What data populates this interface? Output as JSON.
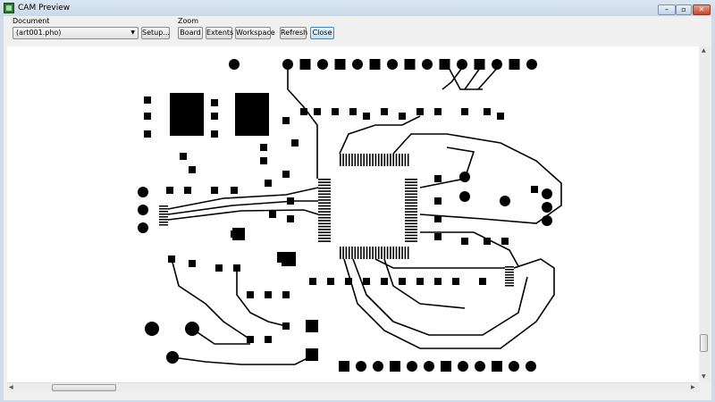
{
  "window": {
    "title": "CAM Preview",
    "app_icon": "cam-icon",
    "controls": {
      "minimize": "–",
      "maximize": "▫",
      "close": "✕"
    }
  },
  "toolbar": {
    "document_label": "Document",
    "document_value": "(art001.pho)",
    "setup_label": "Setup...",
    "zoom_label": "Zoom",
    "board_label": "Board",
    "extents_label": "Extents",
    "workspace_label": "Workspace",
    "refresh_label": "Refresh",
    "close_label": "Close"
  },
  "preview": {
    "artwork_color": "#000000",
    "background": "#ffffff"
  }
}
